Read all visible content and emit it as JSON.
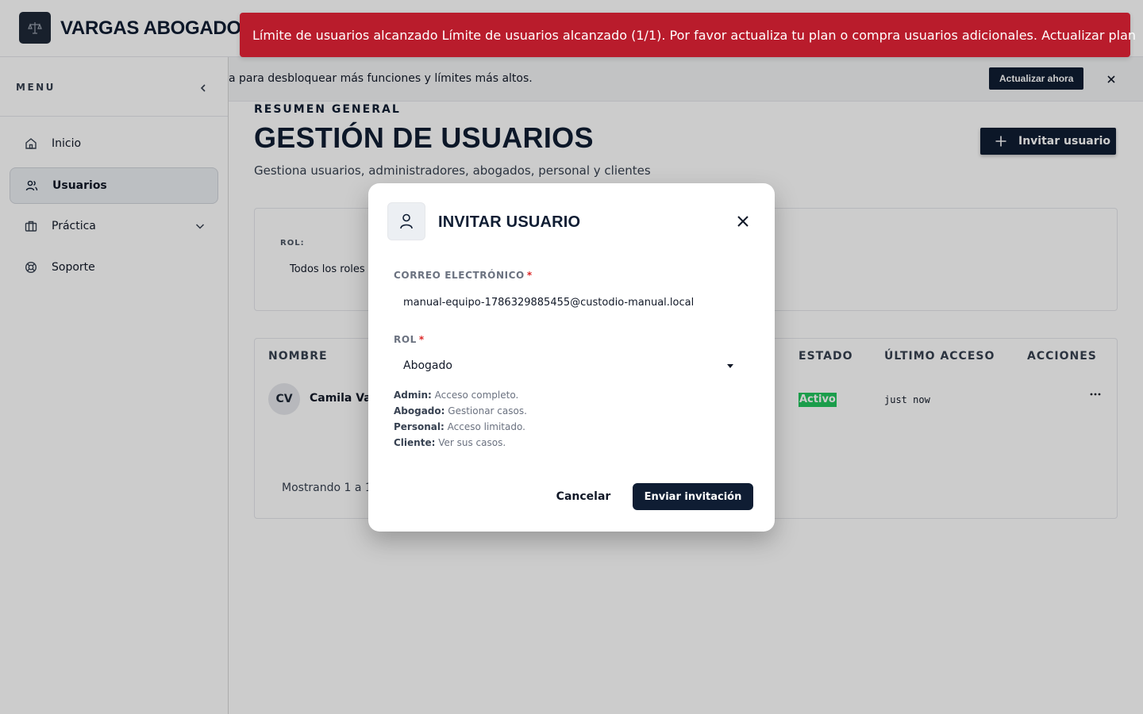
{
  "brand": {
    "name": "VARGAS ABOGADOS",
    "logo_icon": "scales-icon"
  },
  "sidebar": {
    "title": "MENU",
    "collapse_icon": "chevron-left-icon",
    "items": [
      {
        "label": "Inicio",
        "icon": "home-icon",
        "active": false
      },
      {
        "label": "Usuarios",
        "icon": "users-icon",
        "active": true
      },
      {
        "label": "Práctica",
        "icon": "briefcase-icon",
        "active": false,
        "expandable": true
      },
      {
        "label": "Soporte",
        "icon": "lifebuoy-icon",
        "active": false
      }
    ]
  },
  "upgrade_bar": {
    "text": "a para desbloquear más funciones y límites más altos.",
    "button": "Actualizar ahora"
  },
  "page": {
    "eyebrow": "RESUMEN GENERAL",
    "title": "GESTIÓN DE USUARIOS",
    "subtitle": "Gestiona usuarios, administradores, abogados, personal y clientes",
    "invite_button": "Invitar usuario"
  },
  "filters": {
    "role_label": "ROL:",
    "role_value": "Todos los roles"
  },
  "table": {
    "columns": [
      "NOMBRE",
      "ESTADO",
      "ÚLTIMO ACCESO",
      "ACCIONES"
    ],
    "rows": [
      {
        "initials": "CV",
        "name": "Camila Var",
        "status": "Activo",
        "last_access": "just now"
      }
    ],
    "pagination": "Mostrando 1 a 1 d"
  },
  "error_banner": {
    "text": "Límite de usuarios alcanzado Límite de usuarios alcanzado (1/1). Por favor actualiza tu plan o compra usuarios adicionales. Actualizar plan",
    "color": "#b91c2c"
  },
  "modal": {
    "title": "INVITAR USUARIO",
    "email_label": "CORREO ELECTRÓNICO",
    "email_value": "manual-equipo-1786329885455@custodio-manual.local",
    "required_mark": "*",
    "role_label": "ROL",
    "role_value": "Abogado",
    "role_help": [
      {
        "role": "Admin:",
        "desc": "Acceso completo."
      },
      {
        "role": "Abogado:",
        "desc": "Gestionar casos."
      },
      {
        "role": "Personal:",
        "desc": "Acceso limitado."
      },
      {
        "role": "Cliente:",
        "desc": "Ver sus casos."
      }
    ],
    "cancel": "Cancelar",
    "submit": "Enviar invitación"
  },
  "colors": {
    "primary": "#0f1d33",
    "success": "#22c55e",
    "danger": "#b91c2c"
  }
}
